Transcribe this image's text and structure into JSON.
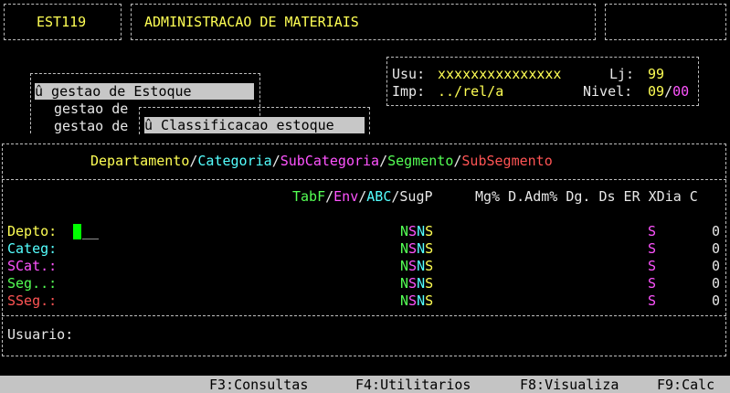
{
  "header": {
    "program_code": "EST119",
    "title": "ADMINISTRACAO DE MATERIAIS"
  },
  "session": {
    "usu_label": "Usu:",
    "usu_value": "xxxxxxxxxxxxxxx",
    "lj_label": "Lj:",
    "lj_value": "99",
    "imp_label": "Imp:",
    "imp_value": "../rel/a",
    "nivel_label": "Nivel:",
    "nivel_value": "09",
    "nivel_sep": "/",
    "nivel_value2": "00"
  },
  "menu": {
    "item1": "û gestao de Estoque",
    "item2": "gestao de",
    "item3": "gestao de",
    "submenu_item": "û Classificacao estoque"
  },
  "hierarchy": {
    "departamento": "Departamento",
    "categoria": "Categoria",
    "subcategoria": "SubCategoria",
    "segmento": "Segmento",
    "subsegmento": "SubSegmento",
    "sep": "/"
  },
  "columns": {
    "tabf": "TabF",
    "env": "Env",
    "abc": "ABC",
    "sugp": "SugP",
    "sep": "/",
    "rest": "Mg% D.Adm% Dg. Ds ER XDia C"
  },
  "rows": [
    {
      "label": "Depto:",
      "flags": [
        "N",
        "S",
        "N",
        "S"
      ],
      "er": "S",
      "c": "0"
    },
    {
      "label": "Categ:",
      "flags": [
        "N",
        "S",
        "N",
        "S"
      ],
      "er": "S",
      "c": "0"
    },
    {
      "label": "SCat.:",
      "flags": [
        "N",
        "S",
        "N",
        "S"
      ],
      "er": "S",
      "c": "0"
    },
    {
      "label": "Seg..:",
      "flags": [
        "N",
        "S",
        "N",
        "S"
      ],
      "er": "S",
      "c": "0"
    },
    {
      "label": "SSeg.:",
      "flags": [
        "N",
        "S",
        "N",
        "S"
      ],
      "er": "S",
      "c": "0"
    }
  ],
  "depto_input_tail": "__",
  "usuario_label": "Usuario:",
  "function_keys": {
    "f3": "F3:Consultas",
    "f4": "F4:Utilitarios",
    "f8": "F8:Visualiza",
    "f9": "F9:Calc"
  }
}
